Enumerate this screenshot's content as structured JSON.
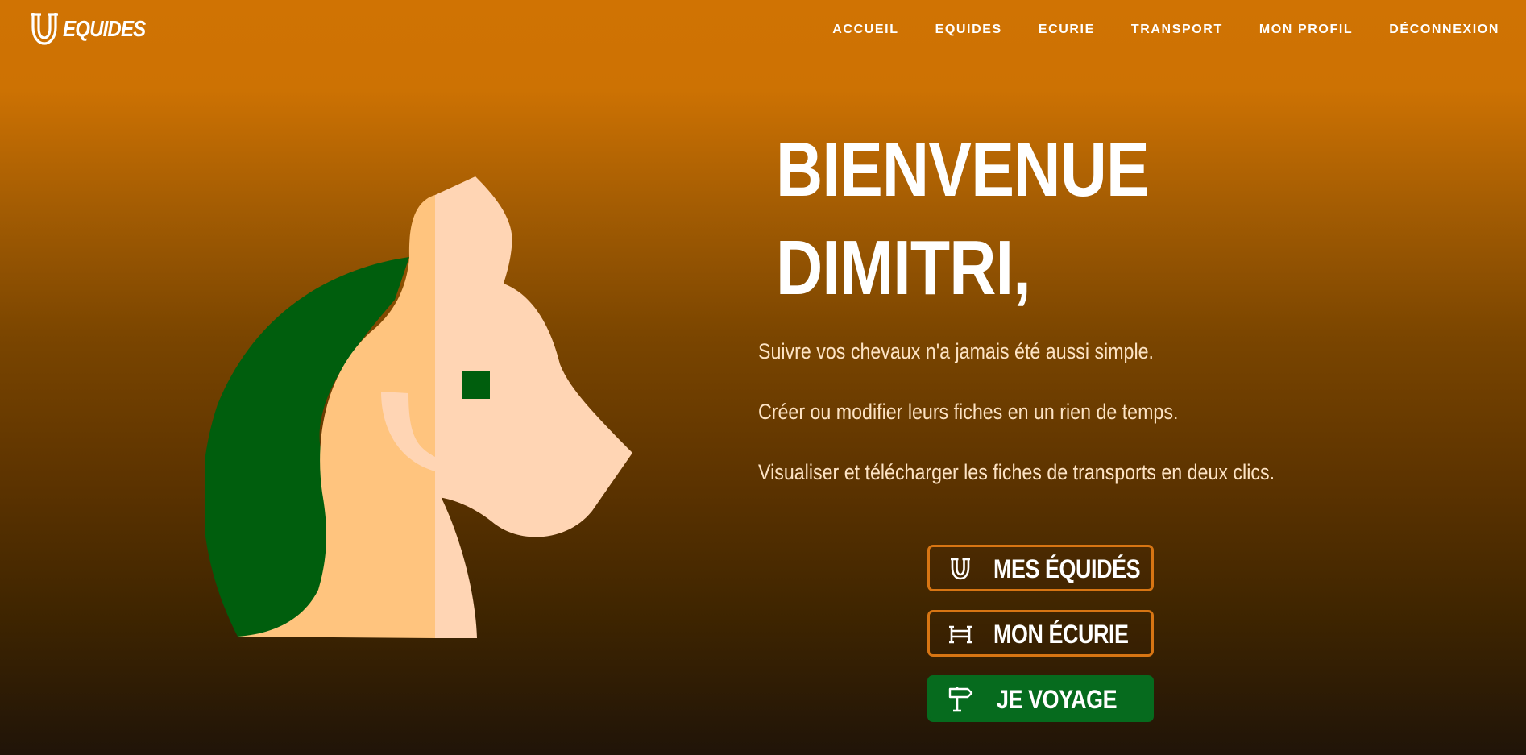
{
  "brand": {
    "name": "EQUIDES",
    "icon": "horseshoe-icon"
  },
  "nav": {
    "items": [
      {
        "label": "ACCUEIL"
      },
      {
        "label": "EQUIDES"
      },
      {
        "label": "ECURIE"
      },
      {
        "label": "TRANSPORT"
      },
      {
        "label": "MON PROFIL"
      },
      {
        "label": "DÉCONNEXION"
      }
    ]
  },
  "hero": {
    "title_line1": "BIENVENUE",
    "title_line2": "DIMITRI,",
    "taglines": [
      "Suivre vos chevaux n'a jamais été aussi simple.",
      "Créer ou modifier leurs fiches en un rien de temps.",
      "Visualiser et télécharger les fiches de transports en deux clics."
    ],
    "illustration": "horse-head-illustration"
  },
  "actions": [
    {
      "label": "MES ÉQUIDÉS",
      "icon": "horseshoe-icon"
    },
    {
      "label": "MON ÉCURIE",
      "icon": "fence-icon"
    },
    {
      "label": "JE VOYAGE",
      "icon": "signpost-icon"
    }
  ],
  "colors": {
    "background_top": "#d07303",
    "background_bottom": "#201408",
    "accent_orange": "#d77513",
    "accent_green": "#066b1e",
    "mane_green": "#005e0d",
    "horse_light": "#ffd5b4",
    "horse_mid": "#ffc47e"
  }
}
